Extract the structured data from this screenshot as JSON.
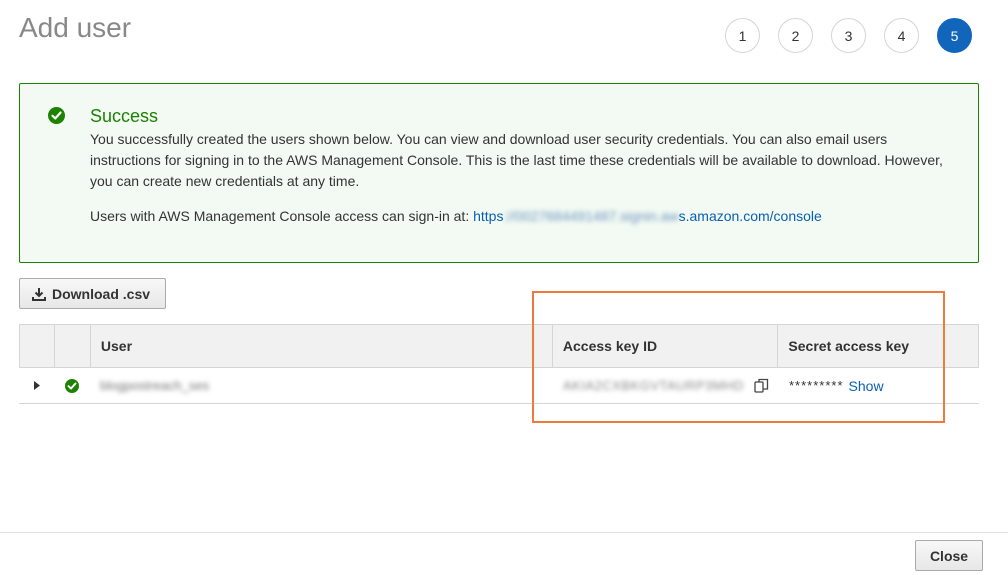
{
  "page": {
    "title": "Add user"
  },
  "steps": [
    {
      "label": "1",
      "active": false
    },
    {
      "label": "2",
      "active": false
    },
    {
      "label": "3",
      "active": false
    },
    {
      "label": "4",
      "active": false
    },
    {
      "label": "5",
      "active": true
    }
  ],
  "success": {
    "title": "Success",
    "message": "You successfully created the users shown below. You can view and download user security credentials. You can also email users instructions for signing in to the AWS Management Console. This is the last time these credentials will be available to download. However, you can create new credentials at any time.",
    "signin_prefix": "Users with AWS Management Console access can sign-in at: ",
    "signin_link_start": "https",
    "signin_link_redacted": "://0027684491487.signin.aw",
    "signin_link_end": "s.amazon.com/console"
  },
  "toolbar": {
    "download_label": "Download .csv"
  },
  "table": {
    "headers": [
      "",
      "",
      "User",
      "Access key ID",
      "Secret access key"
    ],
    "rows": [
      {
        "user": "blogpostreach_ses",
        "access_key_id": "AKIA2CXBKGVTAURP3MHD",
        "secret_mask": "*********",
        "show_label": "Show"
      }
    ]
  },
  "footer": {
    "close_label": "Close"
  },
  "colors": {
    "accent": "#1166bb",
    "success": "#1d8102",
    "highlight": "#ef7a3b",
    "link": "#0a5fb4"
  }
}
